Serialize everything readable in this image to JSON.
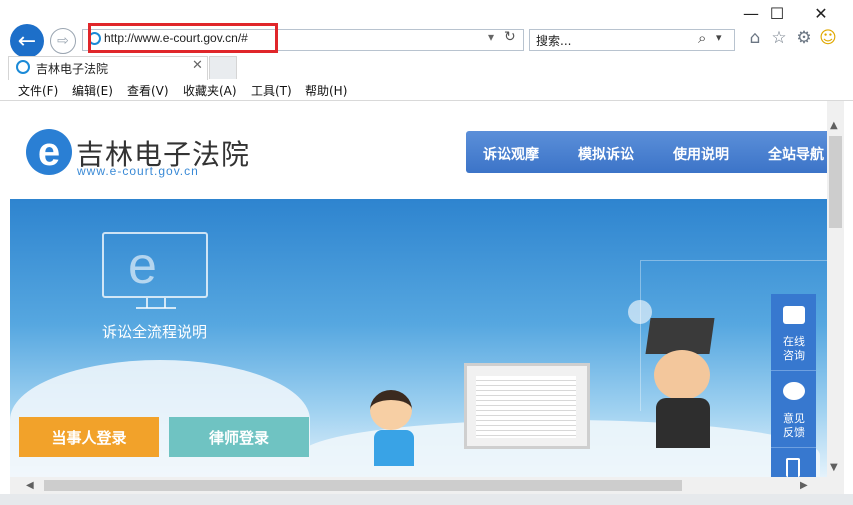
{
  "window": {
    "minimize": "—",
    "maximize": "☐",
    "close": "✕"
  },
  "nav": {
    "back_icon": "←",
    "forward_icon": "⇨",
    "url": "http://www.e-court.gov.cn/#",
    "search_placeholder": "搜索...",
    "search_icon": "⌕",
    "dropdown_icon": "▾",
    "refresh_icon": "↻",
    "home_icon": "⌂",
    "favorites_icon": "☆",
    "settings_icon": "⚙",
    "smiley_icon": "☺"
  },
  "tab": {
    "title": "吉林电子法院",
    "close": "✕"
  },
  "menu": [
    "文件(F)",
    "编辑(E)",
    "查看(V)",
    "收藏夹(A)",
    "工具(T)",
    "帮助(H)"
  ],
  "site": {
    "logo_letter": "e",
    "title": "吉林电子法院",
    "url": "www.e-court.gov.cn",
    "nav": [
      "诉讼观摩",
      "模拟诉讼",
      "使用说明",
      "全站导航"
    ],
    "flow_label": "诉讼全流程说明",
    "btn_party": "当事人登录",
    "btn_lawyer": "律师登录",
    "side": [
      {
        "label": "在线咨询"
      },
      {
        "label": "意见反馈"
      }
    ]
  },
  "scroll": {
    "up": "▲",
    "down": "▼",
    "left": "◀",
    "right": "▶"
  },
  "colors": {
    "accent": "#1d6fc9",
    "highlight": "#e0262a",
    "nav_blue": "#3c74c8",
    "orange": "#f2a22a",
    "teal": "#6fc3c2"
  }
}
